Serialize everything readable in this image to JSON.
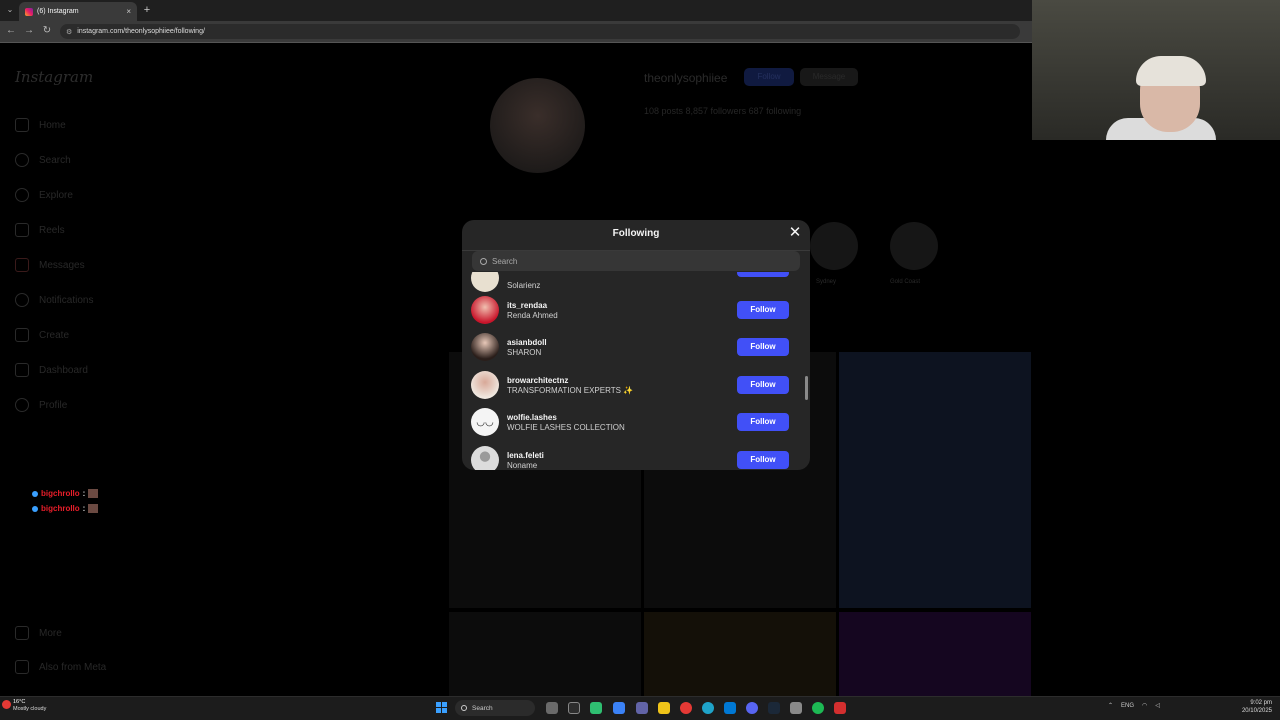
{
  "browser": {
    "tab_title": "(6) Instagram",
    "tab_close": "×",
    "new_tab": "+",
    "url": "instagram.com/theonlysophiiee/following/"
  },
  "sidebar": {
    "logo": "Instagram",
    "items": [
      {
        "label": "Home",
        "icon": "home-icon"
      },
      {
        "label": "Search",
        "icon": "search-icon"
      },
      {
        "label": "Explore",
        "icon": "explore-icon"
      },
      {
        "label": "Reels",
        "icon": "reels-icon"
      },
      {
        "label": "Messages",
        "icon": "messages-icon"
      },
      {
        "label": "Notifications",
        "icon": "heart-icon"
      },
      {
        "label": "Create",
        "icon": "plus-icon"
      },
      {
        "label": "Dashboard",
        "icon": "dashboard-icon"
      },
      {
        "label": "Profile",
        "icon": "profile-icon"
      }
    ],
    "more": "More",
    "also_from_meta": "Also from Meta"
  },
  "profile": {
    "username": "theonlysophiiee",
    "follow_label": "Follow",
    "message_label": "Message",
    "stats": "108 posts    8,857 followers    687 following",
    "highlights": [
      "Sydney",
      "Gold Coast"
    ]
  },
  "chat": {
    "user": "bigchrollo",
    "separator": ":"
  },
  "modal": {
    "title": "Following",
    "close": "✕",
    "search_placeholder": "Search",
    "partial_top_name": "Solarienz",
    "rows": [
      {
        "username": "its_rendaa",
        "fullname": "Renda Ahmed",
        "button": "Follow"
      },
      {
        "username": "asianbdoll",
        "fullname": "SHARON",
        "button": "Follow"
      },
      {
        "username": "browarchitectnz",
        "fullname": "TRANSFORMATION EXPERTS ✨",
        "button": "Follow"
      },
      {
        "username": "wolfie.lashes",
        "fullname": "WOLFIE LASHES COLLECTION",
        "button": "Follow"
      },
      {
        "username": "lena.feleti",
        "fullname": "Noname",
        "button": "Follow"
      }
    ]
  },
  "taskbar": {
    "weather_temp": "16°C",
    "weather_desc": "Mostly cloudy",
    "search_label": "Search",
    "lang": "ENG",
    "time": "9:02 pm",
    "date": "20/10/2025"
  },
  "colors": {
    "follow_button": "#4150f7",
    "modal_bg": "#262626",
    "page_bg": "#000000"
  }
}
